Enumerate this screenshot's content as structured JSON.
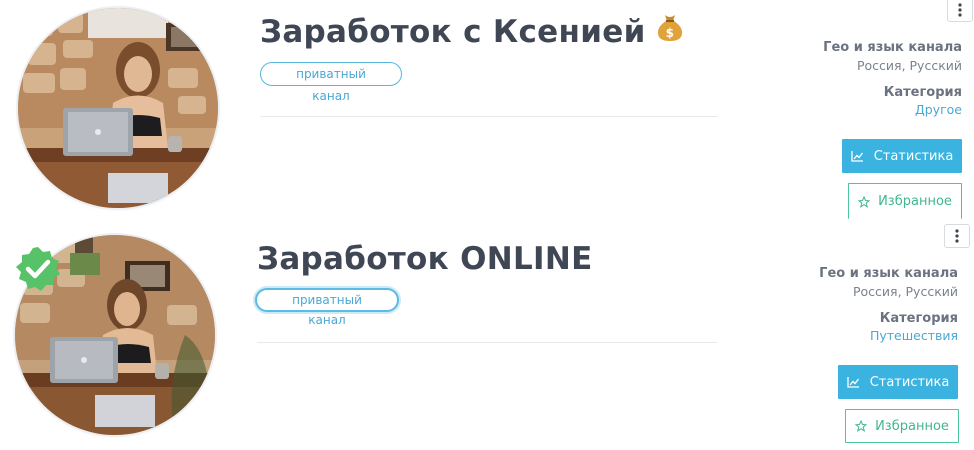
{
  "channels": [
    {
      "title": "Заработок с Ксенией",
      "title_icon": "money-bag-icon",
      "badge": "приватный канал",
      "verified": false,
      "geo_label": "Гео и язык канала",
      "geo_value": "Россия, Русский",
      "category_label": "Категория",
      "category_value": "Другое",
      "stats_button": "Статистика",
      "favorite_button": "Избранное"
    },
    {
      "title": "Заработок ONLINE",
      "badge": "приватный канал",
      "verified": true,
      "verified_icon": "verified-check-icon",
      "geo_label": "Гео и язык канала",
      "geo_value": "Россия, Русский",
      "category_label": "Категория",
      "category_value": "Путешествия",
      "stats_button": "Статистика",
      "favorite_button": "Избранное"
    }
  ],
  "colors": {
    "accent_blue": "#3bb3e0",
    "favorite_green": "#4cc6a1",
    "verified_green": "#57c267",
    "title_text": "#3f4654"
  }
}
